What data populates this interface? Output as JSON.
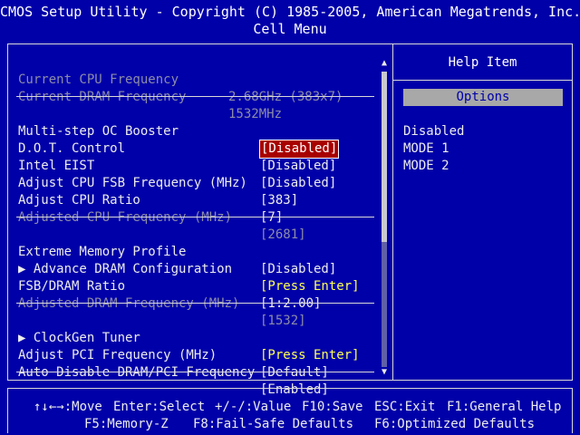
{
  "header": {
    "title": "CMOS Setup Utility - Copyright (C) 1985-2005, American Megatrends, Inc.",
    "menu": "Cell Menu"
  },
  "info": [
    {
      "label": "Current CPU Frequency",
      "value": "2.68GHz (383x7)"
    },
    {
      "label": "Current DRAM Frequency",
      "value": "1532MHz"
    }
  ],
  "settings": [
    {
      "label": "Multi-step OC Booster",
      "value": "[Disabled]"
    },
    {
      "label": "D.O.T. Control",
      "value": "[Disabled]"
    },
    {
      "label": "Intel EIST",
      "value": "[Disabled]"
    },
    {
      "label": "Adjust CPU FSB Frequency (MHz)",
      "value": "[383]"
    },
    {
      "label": "Adjust CPU Ratio",
      "value": "[7]"
    },
    {
      "label": "Adjusted CPU Frequency (MHz)",
      "value": "[2681]"
    },
    {
      "label": "Extreme Memory Profile",
      "value": "[Disabled]"
    },
    {
      "label": "▶ Advance DRAM Configuration",
      "value": "[Press Enter]"
    },
    {
      "label": "FSB/DRAM Ratio",
      "value": "[1:2.00]"
    },
    {
      "label": "Adjusted DRAM Frequency (MHz)",
      "value": "[1532]"
    },
    {
      "label": "▶ ClockGen Tuner",
      "value": "[Press Enter]"
    },
    {
      "label": "Adjust PCI Frequency (MHz)",
      "value": "[Default]"
    },
    {
      "label": "Auto Disable DRAM/PCI Frequency",
      "value": "[Enabled]"
    }
  ],
  "help": {
    "title": "Help Item",
    "options_header": "Options",
    "options": [
      "Disabled",
      "MODE 1",
      "MODE 2"
    ]
  },
  "scroll": {
    "up": "▲",
    "down": "▼"
  },
  "footer": {
    "row1": [
      {
        "key": "↑↓←→",
        "action": ":Move"
      },
      {
        "key": "Enter",
        "action": ":Select"
      },
      {
        "key": "+/-/",
        "action": ":Value"
      },
      {
        "key": "F10",
        "action": ":Save"
      },
      {
        "key": "ESC",
        "action": ":Exit"
      },
      {
        "key": "F1",
        "action": ":General Help"
      }
    ],
    "row2": [
      {
        "key": "F5",
        "action": ":Memory-Z"
      },
      {
        "key": "F8",
        "action": ":Fail-Safe Defaults"
      },
      {
        "key": "F6",
        "action": ":Optimized Defaults"
      }
    ]
  }
}
